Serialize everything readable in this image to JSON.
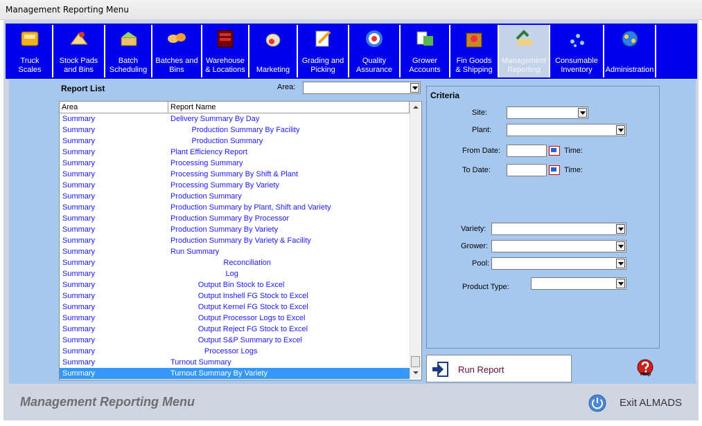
{
  "window": {
    "title": "Management Reporting Menu"
  },
  "toolbar": [
    {
      "label": "Truck\nScales",
      "icon": "truck-scales-icon"
    },
    {
      "label": "Stock Pads\nand Bins",
      "icon": "stock-pads-icon"
    },
    {
      "label": "Batch\nScheduling",
      "icon": "batch-scheduling-icon"
    },
    {
      "label": "Batches and\nBins",
      "icon": "batches-bins-icon"
    },
    {
      "label": "Warehouse\n& Locations",
      "icon": "warehouse-icon"
    },
    {
      "label": "Marketing",
      "icon": "marketing-icon"
    },
    {
      "label": "Grading and\nPicking",
      "icon": "grading-icon"
    },
    {
      "label": "Quality\nAssurance",
      "icon": "quality-icon"
    },
    {
      "label": "Grower\nAccounts",
      "icon": "grower-accounts-icon"
    },
    {
      "label": "Fin Goods\n& Shipping",
      "icon": "fin-goods-icon"
    },
    {
      "label": "Management\nReporting",
      "icon": "management-reporting-icon",
      "active": true
    },
    {
      "label": "Consumable\nInventory",
      "icon": "consumable-inventory-icon"
    },
    {
      "label": "Administration",
      "icon": "administration-icon"
    }
  ],
  "report_list": {
    "title": "Report List",
    "area_label": "Area:",
    "area_value": "",
    "columns": [
      "Area",
      "Report Name"
    ],
    "rows": [
      {
        "area": "Summary",
        "name": "Delivery Summary By Day"
      },
      {
        "area": "Summary",
        "name": "          Production Summary By Facility"
      },
      {
        "area": "Summary",
        "name": "          Production Summary"
      },
      {
        "area": "Summary",
        "name": "Plant Efficiency Report"
      },
      {
        "area": "Summary",
        "name": "Processing Summary"
      },
      {
        "area": "Summary",
        "name": "Processing Summary By Shift & Plant"
      },
      {
        "area": "Summary",
        "name": "Processing Summary By Variety"
      },
      {
        "area": "Summary",
        "name": "Production Summary"
      },
      {
        "area": "Summary",
        "name": "Production Summary by Plant, Shift and Variety"
      },
      {
        "area": "Summary",
        "name": "Production Summary By Processor"
      },
      {
        "area": "Summary",
        "name": "Production Summary By Variety"
      },
      {
        "area": "Summary",
        "name": "Production Summary By Variety & Facility"
      },
      {
        "area": "Summary",
        "name": "Run Summary"
      },
      {
        "area": "Summary",
        "name": "                         Reconciliation"
      },
      {
        "area": "Summary",
        "name": "                          Log"
      },
      {
        "area": "Summary",
        "name": "             Output Bin Stock to Excel"
      },
      {
        "area": "Summary",
        "name": "             Output Inshell FG Stock to Excel"
      },
      {
        "area": "Summary",
        "name": "             Output Kernel FG Stock to Excel"
      },
      {
        "area": "Summary",
        "name": "             Output Processor Logs to Excel"
      },
      {
        "area": "Summary",
        "name": "             Output Reject FG Stock to Excel"
      },
      {
        "area": "Summary",
        "name": "             Output S&P Summary to Excel"
      },
      {
        "area": "Summary",
        "name": "                Processor Logs"
      },
      {
        "area": "Summary",
        "name": "Turnout Summary"
      },
      {
        "area": "Summary",
        "name": "Turnout Summary By Variety",
        "selected": true
      }
    ]
  },
  "criteria": {
    "title": "Criteria",
    "site_label": "Site:",
    "site_value": "",
    "plant_label": "Plant:",
    "plant_value": "",
    "from_date_label": "From Date:",
    "from_date_value": "",
    "to_date_label": "To Date:",
    "to_date_value": "",
    "time_label": "Time:",
    "variety_label": "Variety:",
    "variety_value": "",
    "grower_label": "Grower:",
    "grower_value": "",
    "pool_label": "Pool:",
    "pool_value": "",
    "product_type_label": "Product Type:",
    "product_type_value": ""
  },
  "actions": {
    "run_report": "Run Report",
    "help": "Help",
    "exit": "Exit ALMADS"
  },
  "footer": {
    "title": "Management Reporting Menu"
  },
  "colors": {
    "toolbar": "#0000ee",
    "panel": "#a6c8ef",
    "link": "#1a1aff",
    "selected": "#3399ff"
  }
}
